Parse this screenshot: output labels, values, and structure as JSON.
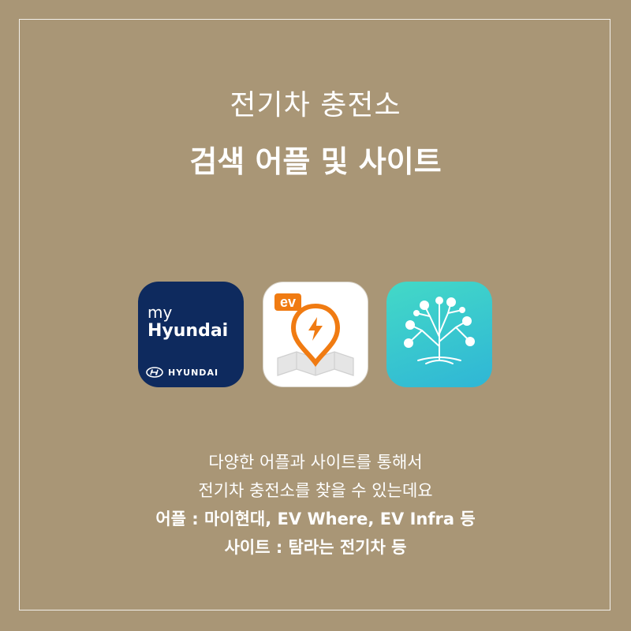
{
  "heading": {
    "line1": "전기차 충전소",
    "line2": "검색 어플 및 사이트"
  },
  "apps": [
    {
      "id": "myhyundai",
      "label_top": "my",
      "label_main": "Hyundai",
      "brand": "HYUNDAI",
      "bg": "#0e2a5e"
    },
    {
      "id": "evwhere",
      "badge": "ev",
      "accent": "#f07b12"
    },
    {
      "id": "evinfra",
      "bg": "#3cc8cf"
    }
  ],
  "body": {
    "line1": "다양한 어플과 사이트를 통해서",
    "line2": "전기차 충전소를 찾을 수 있는데요",
    "line3": "어플 : 마이현대, EV Where, EV Infra 등",
    "line4": "사이트 : 탐라는 전기차 등"
  },
  "colors": {
    "background": "#a99676",
    "text": "#ffffff"
  }
}
